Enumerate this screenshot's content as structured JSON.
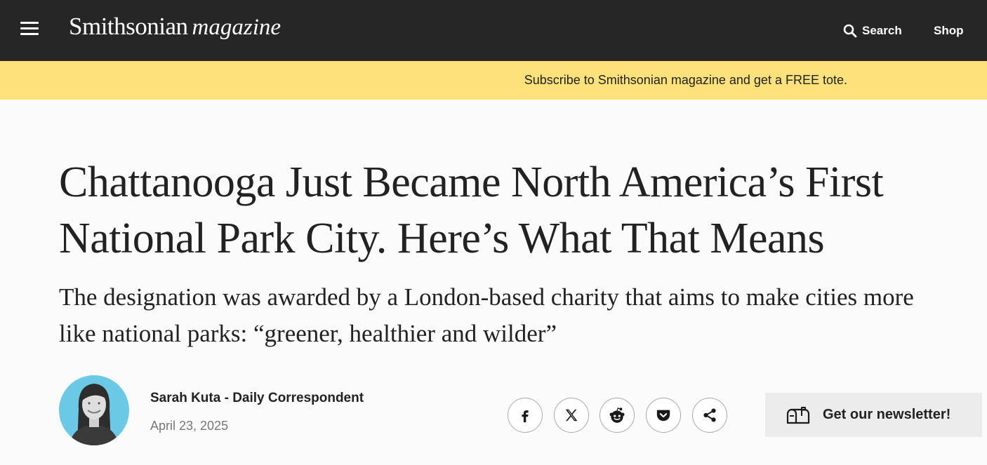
{
  "header": {
    "logo_primary": "Smithsonian",
    "logo_secondary": "magazine",
    "search_label": "Search",
    "shop_label": "Shop"
  },
  "promo": {
    "text": "Subscribe to Smithsonian magazine and get a FREE tote."
  },
  "article": {
    "headline_line1": "Chattanooga Just Became North America’s First",
    "headline_line2": "National Park City. Here’s What That Means",
    "dek_line1": "The designation was awarded by a London-based charity that aims to make cities more",
    "dek_line2": "like national parks: “greener, healthier and wilder”"
  },
  "byline": {
    "author": "Sarah Kuta - Daily Correspondent",
    "date": "April 23, 2025"
  },
  "share": {
    "buttons": [
      "facebook-icon",
      "x-icon",
      "reddit-icon",
      "pocket-icon",
      "share-icon"
    ]
  },
  "newsletter": {
    "label": "Get our newsletter!",
    "icon": "mailbox-icon"
  },
  "colors": {
    "topbar": "#262626",
    "promo": "#fde27c",
    "avatar_bg": "#6cc9e6"
  }
}
